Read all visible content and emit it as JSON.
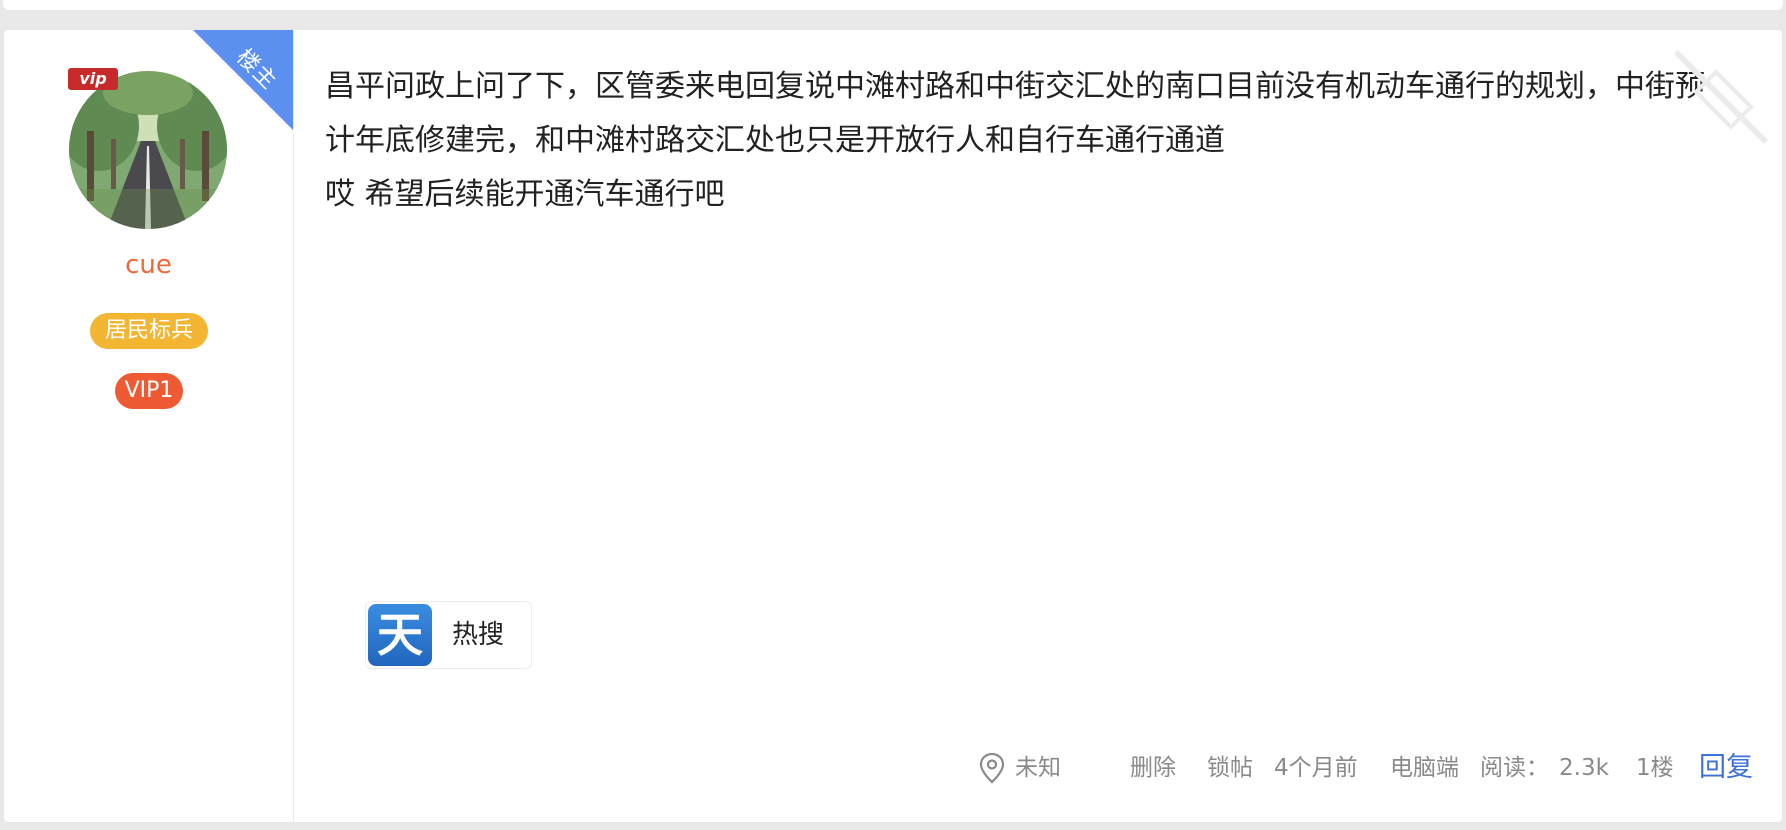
{
  "post": {
    "corner_label": "楼主",
    "author": {
      "name": "cue",
      "vip_crown": "vip",
      "level_badge": "居民标兵",
      "vip_badge": "VIP1"
    },
    "content": {
      "line1": "昌平问政上问了下，区管委来电回复说中滩村路和中街交汇处的南口目前没有机动车通行的规划，中街预计年底修建完，和中滩村路交汇处也只是开放行人和自行车通行通道",
      "line2": "哎 希望后续能开通汽车通行吧"
    },
    "attachment": {
      "logo_char": "天",
      "label": "热搜"
    },
    "footer": {
      "location": "未知",
      "delete_label": "删除",
      "lock_label": "锁帖",
      "time": "4个月前",
      "device": "电脑端",
      "read_label": "阅读：",
      "read_count": "2.3k",
      "floor": "1楼",
      "reply_label": "回复"
    }
  },
  "colors": {
    "accent_blue": "#3c72d8",
    "ribbon_blue": "#5b8ff0",
    "author_orange": "#ef6a3a",
    "level_yellow": "#f2b632",
    "vip_red": "#ee5a33"
  }
}
